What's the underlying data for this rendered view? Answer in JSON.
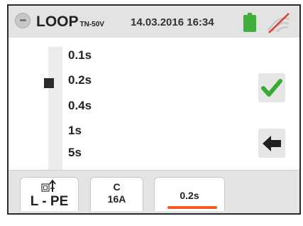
{
  "header": {
    "title": "LOOP",
    "title_subscript": "TN-50V",
    "datetime": "14.03.2016 16:34",
    "menu_icon": "ellipsis-icon",
    "battery_icon": "battery-icon",
    "battery_color": "#3fae3a",
    "signal_icon": "wifi-off-icon",
    "signal_slash_color": "#e23b2e"
  },
  "options": {
    "items": [
      "0.1s",
      "0.2s",
      "0.4s",
      "1s",
      "5s"
    ],
    "selected": "0.2s"
  },
  "actions": {
    "confirm_icon": "checkmark-icon",
    "confirm_color": "#3aaa35",
    "back_icon": "arrow-left-icon"
  },
  "footer": {
    "mode_label": "L - PE",
    "mode_icon": "earth-plug-icon",
    "curve_line1": "C",
    "curve_line2": "16A",
    "time_label": "0.2s",
    "active_tab_color": "#f05a24"
  }
}
